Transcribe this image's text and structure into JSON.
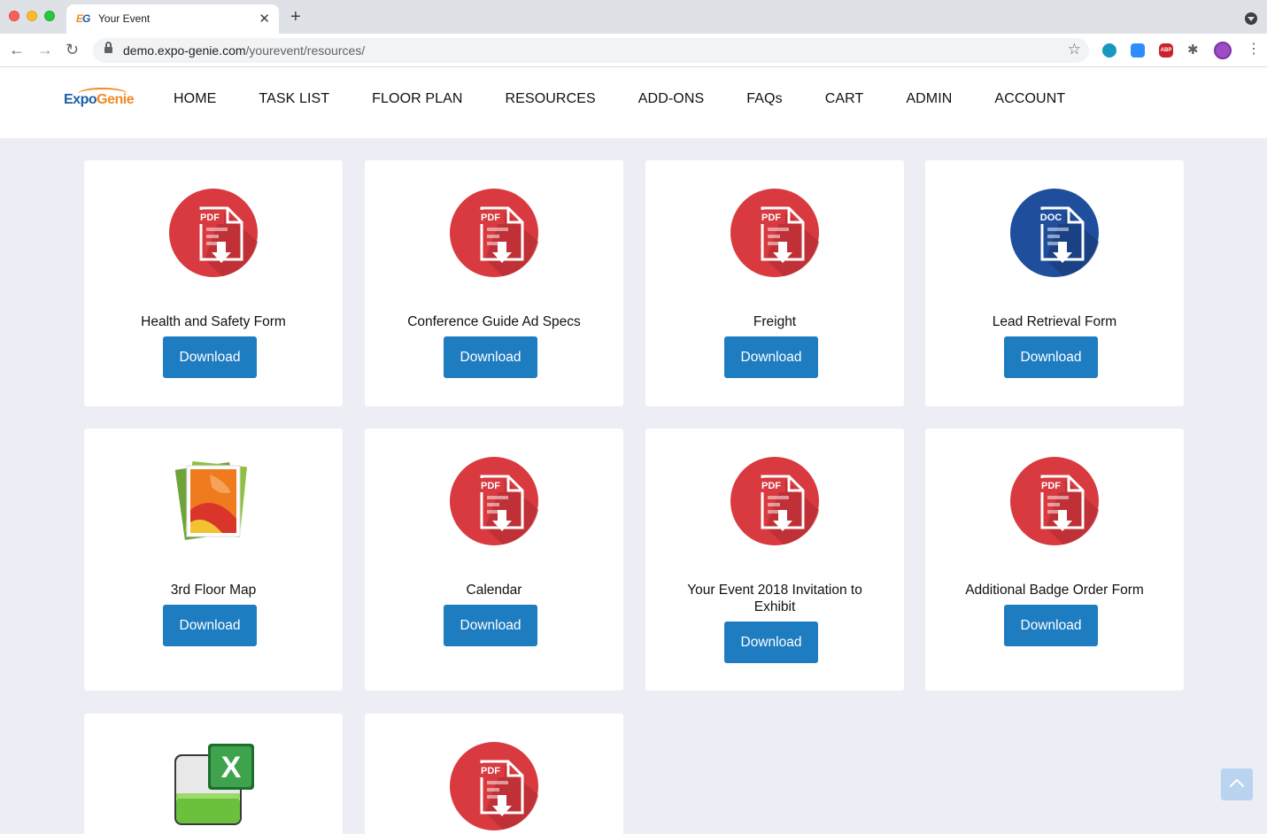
{
  "browser": {
    "tab_title": "Your Event",
    "tab_favicon": {
      "e": "E",
      "g": "G"
    },
    "url_host": "demo.expo-genie.com",
    "url_path": "/yourevent/resources/",
    "ext_abp_label": "ABP"
  },
  "site": {
    "logo": {
      "expo": "Expo",
      "genie": "Genie"
    },
    "nav": [
      "HOME",
      "TASK LIST",
      "FLOOR PLAN",
      "RESOURCES",
      "ADD-ONS",
      "FAQs",
      "CART",
      "ADMIN",
      "ACCOUNT"
    ]
  },
  "resources": [
    {
      "title": "Health and Safety Form",
      "icon": "pdf-icon",
      "button": "Download"
    },
    {
      "title": "Conference Guide Ad Specs",
      "icon": "pdf-icon",
      "button": "Download"
    },
    {
      "title": "Freight",
      "icon": "pdf-icon",
      "button": "Download"
    },
    {
      "title": "Lead Retrieval Form",
      "icon": "doc-icon",
      "button": "Download"
    },
    {
      "title": "3rd Floor Map",
      "icon": "image-icon",
      "button": "Download"
    },
    {
      "title": "Calendar",
      "icon": "pdf-icon",
      "button": "Download"
    },
    {
      "title": "Your Event 2018 Invitation to Exhibit",
      "icon": "pdf-icon",
      "button": "Download"
    },
    {
      "title": "Additional Badge Order Form",
      "icon": "pdf-icon",
      "button": "Download"
    },
    {
      "title": "",
      "icon": "excel-icon",
      "button": ""
    },
    {
      "title": "",
      "icon": "pdf-icon",
      "button": ""
    }
  ],
  "icon_labels": {
    "pdf": "PDF",
    "doc": "DOC"
  },
  "colors": {
    "pdf": "#d83a3f",
    "doc": "#1f4e9c",
    "button": "#1e7cc0",
    "background": "#ecedf5"
  }
}
